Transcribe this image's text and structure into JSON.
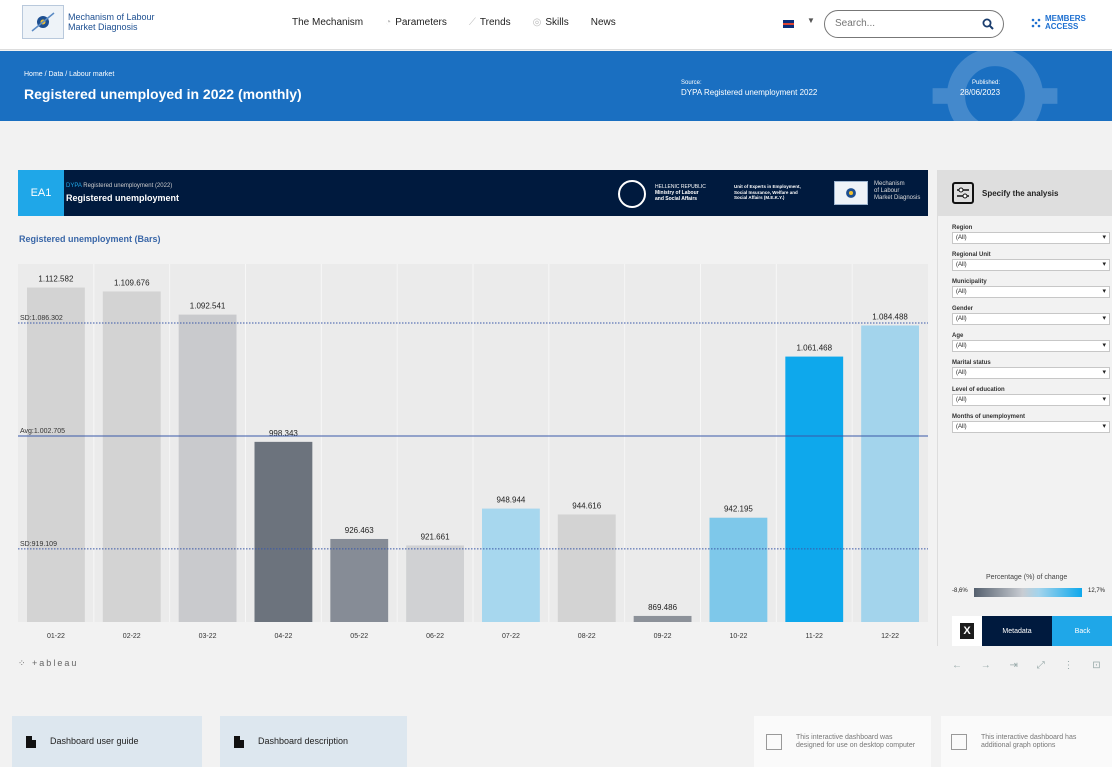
{
  "nav": {
    "logo_text": "Mechanism of Labour Market Diagnosis",
    "links": [
      "The Mechanism",
      "Parameters",
      "Trends",
      "Skills",
      "News"
    ],
    "search_placeholder": "Search...",
    "members": [
      "MEMBERS",
      "ACCESS"
    ]
  },
  "header": {
    "breadcrumb": "Home / Data / Labour market",
    "title": "Registered unemployed in 2022 (monthly)",
    "source_label": "Source:",
    "source": "DYPA Registered unemployment 2022",
    "published_label": "Published:",
    "published": "28/06/2023"
  },
  "banner": {
    "code": "EA1",
    "sub_prefix": "DYPA",
    "sub": "Registered unemployment (2022)",
    "title": "Registered unemployment",
    "ministry": [
      "HELLENIC REPUBLIC",
      "Ministry of Labour",
      "and Social Affairs"
    ],
    "unit": [
      "Unit of Experts in Employment,",
      "Social Insurance, Welfare and",
      "Social Affairs (M.E.K.Y.)"
    ],
    "mech": [
      "Mechanism",
      "of Labour",
      "Market Diagnosis"
    ]
  },
  "sidebar": {
    "specify": "Specify the analysis",
    "filters": [
      {
        "label": "Region",
        "value": "(All)"
      },
      {
        "label": "Regional Unit",
        "value": "(All)"
      },
      {
        "label": "Municipality",
        "value": "(All)"
      },
      {
        "label": "Gender",
        "value": "(All)"
      },
      {
        "label": "Age",
        "value": "(All)"
      },
      {
        "label": "Marital status",
        "value": "(All)"
      },
      {
        "label": "Level of education",
        "value": "(All)"
      },
      {
        "label": "Months of unemployment",
        "value": "(All)"
      }
    ],
    "legend_title": "Percentage (%) of change",
    "legend_min": "-8,6%",
    "legend_max": "12,7%",
    "metadata": "Metadata",
    "back": "Back"
  },
  "chart_data": {
    "type": "bar",
    "title": "Registered unemployment (Bars)",
    "categories": [
      "01-22",
      "02-22",
      "03-22",
      "04-22",
      "05-22",
      "06-22",
      "07-22",
      "08-22",
      "09-22",
      "10-22",
      "11-22",
      "12-22"
    ],
    "values": [
      1112582,
      1109676,
      1092541,
      998343,
      926463,
      921661,
      948944,
      944616,
      869486,
      942195,
      1061468,
      1084488
    ],
    "value_labels": [
      "1.112.582",
      "1.109.676",
      "1.092.541",
      "998.343",
      "926.463",
      "921.661",
      "948.944",
      "944.616",
      "869.486",
      "942.195",
      "1.061.468",
      "1.084.488"
    ],
    "colors": [
      "#d3d3d3",
      "#d3d3d3",
      "#c9cacd",
      "#6c737d",
      "#868c96",
      "#d0d1d3",
      "#a7d7ee",
      "#d3d3d3",
      "#8c9199",
      "#7ec8ea",
      "#0ea8ec",
      "#a3d4ec"
    ],
    "ylim": [
      865000,
      1130000
    ],
    "reference_lines": [
      {
        "label": "SD:1.086.302",
        "value": 1086302,
        "style": "dotted"
      },
      {
        "label": "Avg:1.002.705",
        "value": 1002705,
        "style": "solid"
      },
      {
        "label": "SD:919.109",
        "value": 919109,
        "style": "dotted"
      }
    ],
    "grid": true
  },
  "footer": {
    "guide": "Dashboard user guide",
    "description": "Dashboard description",
    "desktop_note": "This interactive dashboard was designed for use on desktop computer",
    "graph_note": "This interactive dashboard has additional graph options"
  },
  "tableau": "+ableau"
}
